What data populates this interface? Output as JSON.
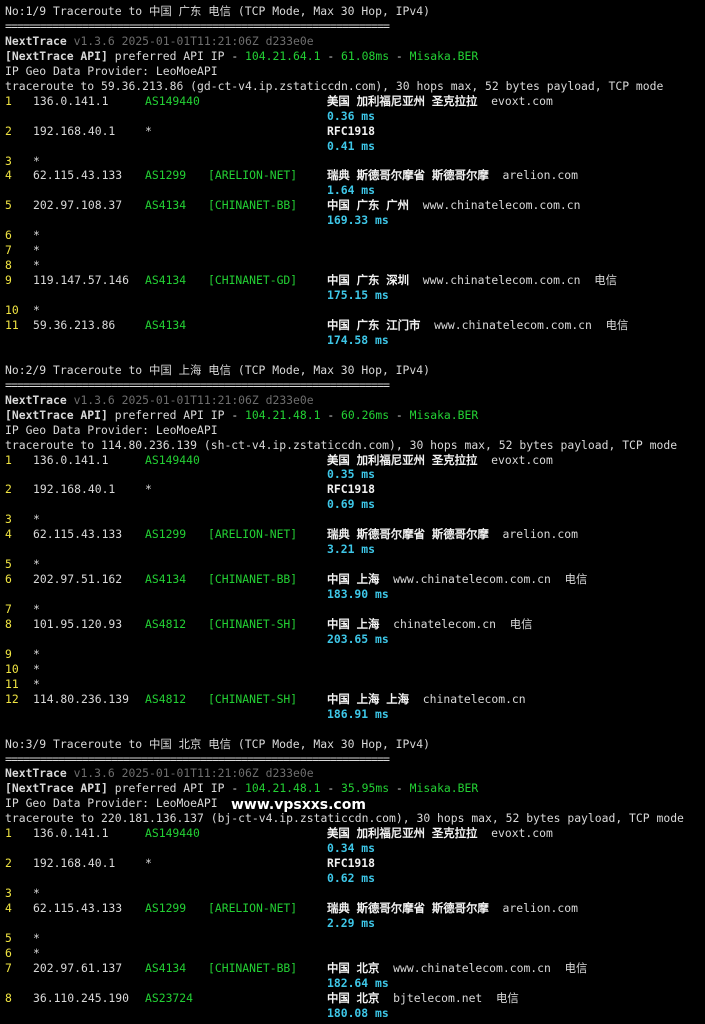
{
  "colors": {
    "background": "#000000",
    "text": "#d9d9d9",
    "hop": "#f0e442",
    "asn": "#23d134",
    "latency": "#3ec7e8",
    "geo": "#f2f2f2",
    "version": "#6e6e6e"
  },
  "watermark": "www.vpsxxs.com",
  "sections": [
    {
      "title": "No:1/9 Traceroute to 中国 广东 电信 (TCP Mode, Max 30 Hop, IPv4)",
      "separator": "=================================================================",
      "app": "NextTrace",
      "version": "v1.3.6 2025-01-01T11:21:06Z d233e0e",
      "api_tag": "[NextTrace API]",
      "api_text": " preferred API IP - ",
      "api_ip": "104.21.64.1",
      "api_dash1": " - ",
      "api_latency": "61.08ms",
      "api_dash2": " - ",
      "api_node": "Misaka.BER",
      "geo_provider": "IP Geo Data Provider: LeoMoeAPI",
      "target": "traceroute to 59.36.213.86 (gd-ct-v4.ip.zstaticcdn.com), 30 hops max, 52 bytes payload, TCP mode",
      "hops": [
        {
          "n": "1",
          "ip": "136.0.141.1",
          "asn": "AS149440",
          "net": "",
          "geo": "美国 加利福尼亚州 圣克拉拉",
          "dom": "evoxt.com",
          "isp": "",
          "ms": "0.36 ms"
        },
        {
          "n": "2",
          "ip": "192.168.40.1",
          "asn": "*",
          "net": "",
          "geo": "RFC1918",
          "dom": "",
          "isp": "",
          "ms": "0.41 ms"
        },
        {
          "n": "3",
          "ip": "*"
        },
        {
          "n": "4",
          "ip": "62.115.43.133",
          "asn": "AS1299",
          "net": "[ARELION-NET]",
          "geo": "瑞典 斯德哥尔摩省 斯德哥尔摩",
          "dom": "arelion.com",
          "isp": "",
          "ms": "1.64 ms"
        },
        {
          "n": "5",
          "ip": "202.97.108.37",
          "asn": "AS4134",
          "net": "[CHINANET-BB]",
          "geo": "中国 广东 广州",
          "dom": "www.chinatelecom.com.cn",
          "isp": "",
          "ms": "169.33 ms"
        },
        {
          "n": "6",
          "ip": "*"
        },
        {
          "n": "7",
          "ip": "*"
        },
        {
          "n": "8",
          "ip": "*"
        },
        {
          "n": "9",
          "ip": "119.147.57.146",
          "asn": "AS4134",
          "net": "[CHINANET-GD]",
          "geo": "中国 广东 深圳",
          "dom": "www.chinatelecom.com.cn",
          "isp": "电信",
          "ms": "175.15 ms"
        },
        {
          "n": "10",
          "ip": "*"
        },
        {
          "n": "11",
          "ip": "59.36.213.86",
          "asn": "AS4134",
          "net": "",
          "geo": "中国 广东 江门市",
          "dom": "www.chinatelecom.com.cn",
          "isp": "电信",
          "ms": "174.58 ms"
        }
      ]
    },
    {
      "title": "No:2/9 Traceroute to 中国 上海 电信 (TCP Mode, Max 30 Hop, IPv4)",
      "separator": "=================================================================",
      "app": "NextTrace",
      "version": "v1.3.6 2025-01-01T11:21:06Z d233e0e",
      "api_tag": "[NextTrace API]",
      "api_text": " preferred API IP - ",
      "api_ip": "104.21.48.1",
      "api_dash1": " - ",
      "api_latency": "60.26ms",
      "api_dash2": " - ",
      "api_node": "Misaka.BER",
      "geo_provider": "IP Geo Data Provider: LeoMoeAPI",
      "target": "traceroute to 114.80.236.139 (sh-ct-v4.ip.zstaticcdn.com), 30 hops max, 52 bytes payload, TCP mode",
      "hops": [
        {
          "n": "1",
          "ip": "136.0.141.1",
          "asn": "AS149440",
          "net": "",
          "geo": "美国 加利福尼亚州 圣克拉拉",
          "dom": "evoxt.com",
          "isp": "",
          "ms": "0.35 ms"
        },
        {
          "n": "2",
          "ip": "192.168.40.1",
          "asn": "*",
          "net": "",
          "geo": "RFC1918",
          "dom": "",
          "isp": "",
          "ms": "0.69 ms"
        },
        {
          "n": "3",
          "ip": "*"
        },
        {
          "n": "4",
          "ip": "62.115.43.133",
          "asn": "AS1299",
          "net": "[ARELION-NET]",
          "geo": "瑞典 斯德哥尔摩省 斯德哥尔摩",
          "dom": "arelion.com",
          "isp": "",
          "ms": "3.21 ms"
        },
        {
          "n": "5",
          "ip": "*"
        },
        {
          "n": "6",
          "ip": "202.97.51.162",
          "asn": "AS4134",
          "net": "[CHINANET-BB]",
          "geo": "中国 上海",
          "dom": "www.chinatelecom.com.cn",
          "isp": "电信",
          "ms": "183.90 ms"
        },
        {
          "n": "7",
          "ip": "*"
        },
        {
          "n": "8",
          "ip": "101.95.120.93",
          "asn": "AS4812",
          "net": "[CHINANET-SH]",
          "geo": "中国 上海",
          "dom": "chinatelecom.cn",
          "isp": "电信",
          "ms": "203.65 ms"
        },
        {
          "n": "9",
          "ip": "*"
        },
        {
          "n": "10",
          "ip": "*"
        },
        {
          "n": "11",
          "ip": "*"
        },
        {
          "n": "12",
          "ip": "114.80.236.139",
          "asn": "AS4812",
          "net": "[CHINANET-SH]",
          "geo": "中国 上海 上海",
          "dom": "chinatelecom.cn",
          "isp": "",
          "ms": "186.91 ms"
        }
      ]
    },
    {
      "title": "No:3/9 Traceroute to 中国 北京 电信 (TCP Mode, Max 30 Hop, IPv4)",
      "separator": "=================================================================",
      "app": "NextTrace",
      "version": "v1.3.6 2025-01-01T11:21:06Z d233e0e",
      "api_tag": "[NextTrace API]",
      "api_text": " preferred API IP - ",
      "api_ip": "104.21.48.1",
      "api_dash1": " - ",
      "api_latency": "35.95ms",
      "api_dash2": " - ",
      "api_node": "Misaka.BER",
      "geo_provider": "IP Geo Data Provider: LeoMoeAPI",
      "target": "traceroute to 220.181.136.137 (bj-ct-v4.ip.zstaticcdn.com), 30 hops max, 52 bytes payload, TCP mode",
      "hops": [
        {
          "n": "1",
          "ip": "136.0.141.1",
          "asn": "AS149440",
          "net": "",
          "geo": "美国 加利福尼亚州 圣克拉拉",
          "dom": "evoxt.com",
          "isp": "",
          "ms": "0.34 ms"
        },
        {
          "n": "2",
          "ip": "192.168.40.1",
          "asn": "*",
          "net": "",
          "geo": "RFC1918",
          "dom": "",
          "isp": "",
          "ms": "0.62 ms"
        },
        {
          "n": "3",
          "ip": "*"
        },
        {
          "n": "4",
          "ip": "62.115.43.133",
          "asn": "AS1299",
          "net": "[ARELION-NET]",
          "geo": "瑞典 斯德哥尔摩省 斯德哥尔摩",
          "dom": "arelion.com",
          "isp": "",
          "ms": "2.29 ms"
        },
        {
          "n": "5",
          "ip": "*"
        },
        {
          "n": "6",
          "ip": "*"
        },
        {
          "n": "7",
          "ip": "202.97.61.137",
          "asn": "AS4134",
          "net": "[CHINANET-BB]",
          "geo": "中国 北京",
          "dom": "www.chinatelecom.com.cn",
          "isp": "电信",
          "ms": "182.64 ms"
        },
        {
          "n": "8",
          "ip": "36.110.245.190",
          "asn": "AS23724",
          "net": "",
          "geo": "中国 北京",
          "dom": "bjtelecom.net",
          "isp": "电信",
          "ms": "180.08 ms"
        }
      ]
    }
  ]
}
